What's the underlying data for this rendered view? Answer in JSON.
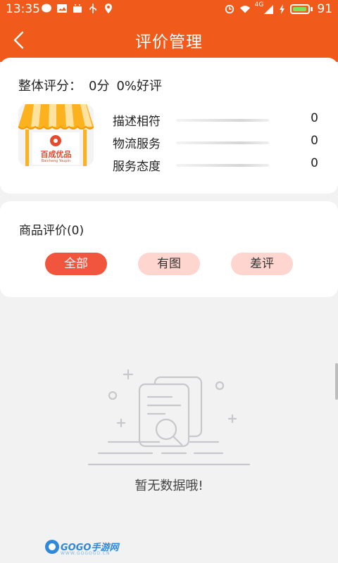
{
  "status_bar": {
    "time": "13:35",
    "network": "4G",
    "battery_level": "91",
    "left_icons": [
      "message-icon",
      "image-icon",
      "android-icon",
      "usb-icon",
      "location-icon"
    ],
    "right_icons": [
      "alarm-icon",
      "wifi-icon",
      "signal-icon",
      "charging-icon",
      "battery-icon"
    ]
  },
  "header": {
    "title": "评价管理",
    "back_icon": "chevron-left-icon"
  },
  "summary": {
    "overall_label": "整体评分：",
    "score": "0分",
    "positive_rate": "0%好评",
    "logo_text": "百成优品",
    "logo_subtext": "Baicheng Youpin",
    "ratings": [
      {
        "label": "描述相符",
        "value": "0"
      },
      {
        "label": "物流服务",
        "value": "0"
      },
      {
        "label": "服务态度",
        "value": "0"
      }
    ]
  },
  "reviews": {
    "heading": "商品评价(0)",
    "filters": [
      {
        "label": "全部",
        "active": true
      },
      {
        "label": "有图",
        "active": false
      },
      {
        "label": "差评",
        "active": false
      }
    ]
  },
  "empty_state": {
    "message": "暂无数据哦!",
    "illustration_icon": "empty-document-search-icon"
  },
  "watermark": {
    "text": "GOGO手游网",
    "subtext": "WWW.GOGOGO.CN"
  },
  "colors": {
    "brand": "#f05b1c",
    "active_pill": "#f2553d",
    "inactive_pill": "#ffd5d0",
    "background": "#f2f2f2"
  }
}
